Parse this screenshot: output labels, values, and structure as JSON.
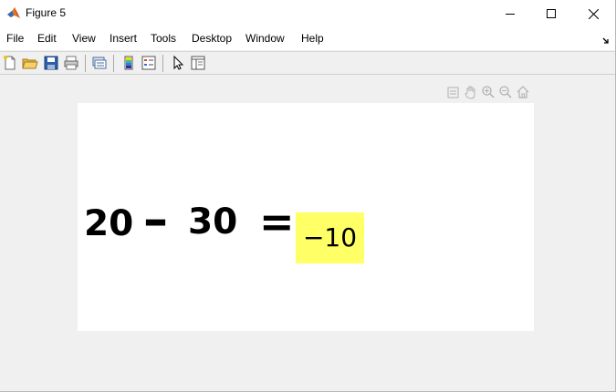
{
  "window": {
    "title": "Figure 5",
    "icon": "matlab-icon",
    "controls": [
      "minimize-icon",
      "maximize-icon",
      "close-icon"
    ]
  },
  "menubar": {
    "items": [
      "File",
      "Edit",
      "View",
      "Insert",
      "Tools",
      "Desktop",
      "Window",
      "Help"
    ],
    "overflow_icon": "dock-arrow-icon"
  },
  "toolbar": {
    "buttons": [
      "new-figure-icon",
      "open-file-icon",
      "save-icon",
      "print-icon",
      "link-plot-icon",
      "insert-colorbar-icon",
      "insert-legend-icon",
      "edit-plot-icon",
      "property-inspector-icon"
    ]
  },
  "axes_toolbar": {
    "buttons": [
      "export-icon",
      "pan-icon",
      "zoom-in-icon",
      "zoom-out-icon",
      "home-icon"
    ]
  },
  "figure": {
    "operand_a": "20",
    "operator": "–",
    "operand_b": "30",
    "equals": "=",
    "result": "−10",
    "result_background": "#ffff66"
  },
  "colors": {
    "window_bg": "#f0f0f0",
    "title_bg": "#ffffff",
    "canvas_bg": "#ffffff"
  }
}
